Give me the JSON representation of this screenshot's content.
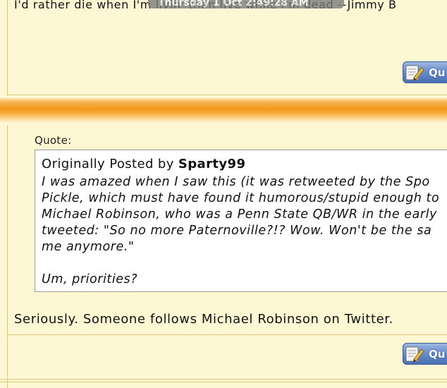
{
  "top_post": {
    "signature": "I'd rather die when I'm livin' than live while I'm dead --Jimmy B",
    "tooltip": "Thursday 1 Oct 2:49:28 AM"
  },
  "post": {
    "quote_label": "Quote:",
    "quote_prefix": "Originally Posted by",
    "quote_author": "Sparty99",
    "quote_lines": [
      "I was amazed when I saw this (it was retweeted by the Spo",
      "Pickle, which must have found it humorous/stupid enough to",
      "Michael Robinson, who was a Penn State QB/WR in the early",
      "tweeted: \"So no more Paternoville?!? Wow. Won't be the sa",
      "me anymore.\"",
      "",
      "Um, priorities?"
    ],
    "reply": "Seriously. Someone follows Michael Robinson on Twitter."
  },
  "buttons": {
    "quote_label": "Qu"
  },
  "colors": {
    "background": "#fdf8d3",
    "separator_orange": "#f09a1c",
    "button_blue": "#6a8fcc",
    "rule": "#e2c77a"
  }
}
